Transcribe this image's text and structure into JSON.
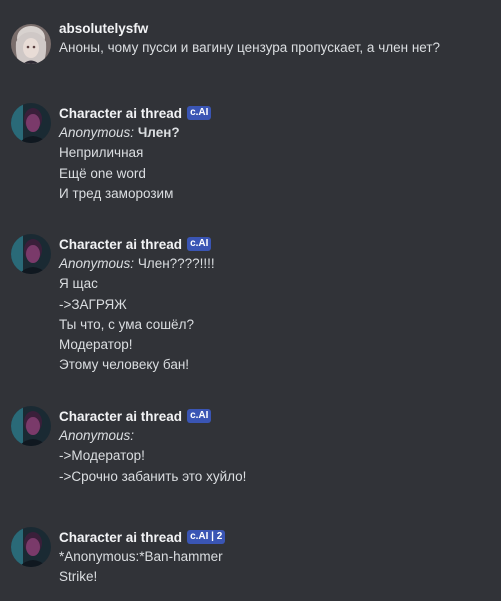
{
  "messages": [
    {
      "author": "absolutelysfw",
      "lines": [
        "Аноны, чому пусси и вагину цензура пропускает, а член нет?"
      ]
    },
    {
      "author": "Character ai thread",
      "tag": "c.AI",
      "anon_label": "Anonymous:",
      "anon_text": "Член?",
      "lines": [
        "Неприличная",
        "Ещё one word",
        "И тред заморозим"
      ]
    },
    {
      "author": "Character ai thread",
      "tag": "c.AI",
      "anon_label": "Anonymous:",
      "anon_text": "Член????!!!!",
      "lines": [
        "Я щас",
        "->ЗАГРЯЖ",
        "Ты что, с ума сошёл?",
        "Модератор!",
        "Этому человеку бан!"
      ]
    },
    {
      "author": "Character ai thread",
      "tag": "c.AI",
      "anon_label": "Anonymous:",
      "lines": [
        "->Модератор!",
        "->Срочно забанить это хуйло!"
      ]
    },
    {
      "author": "Character ai thread",
      "tag": "c.AI | 2",
      "lines": [
        "*Anonymous:*Ban-hammer",
        "Strike!"
      ]
    }
  ]
}
